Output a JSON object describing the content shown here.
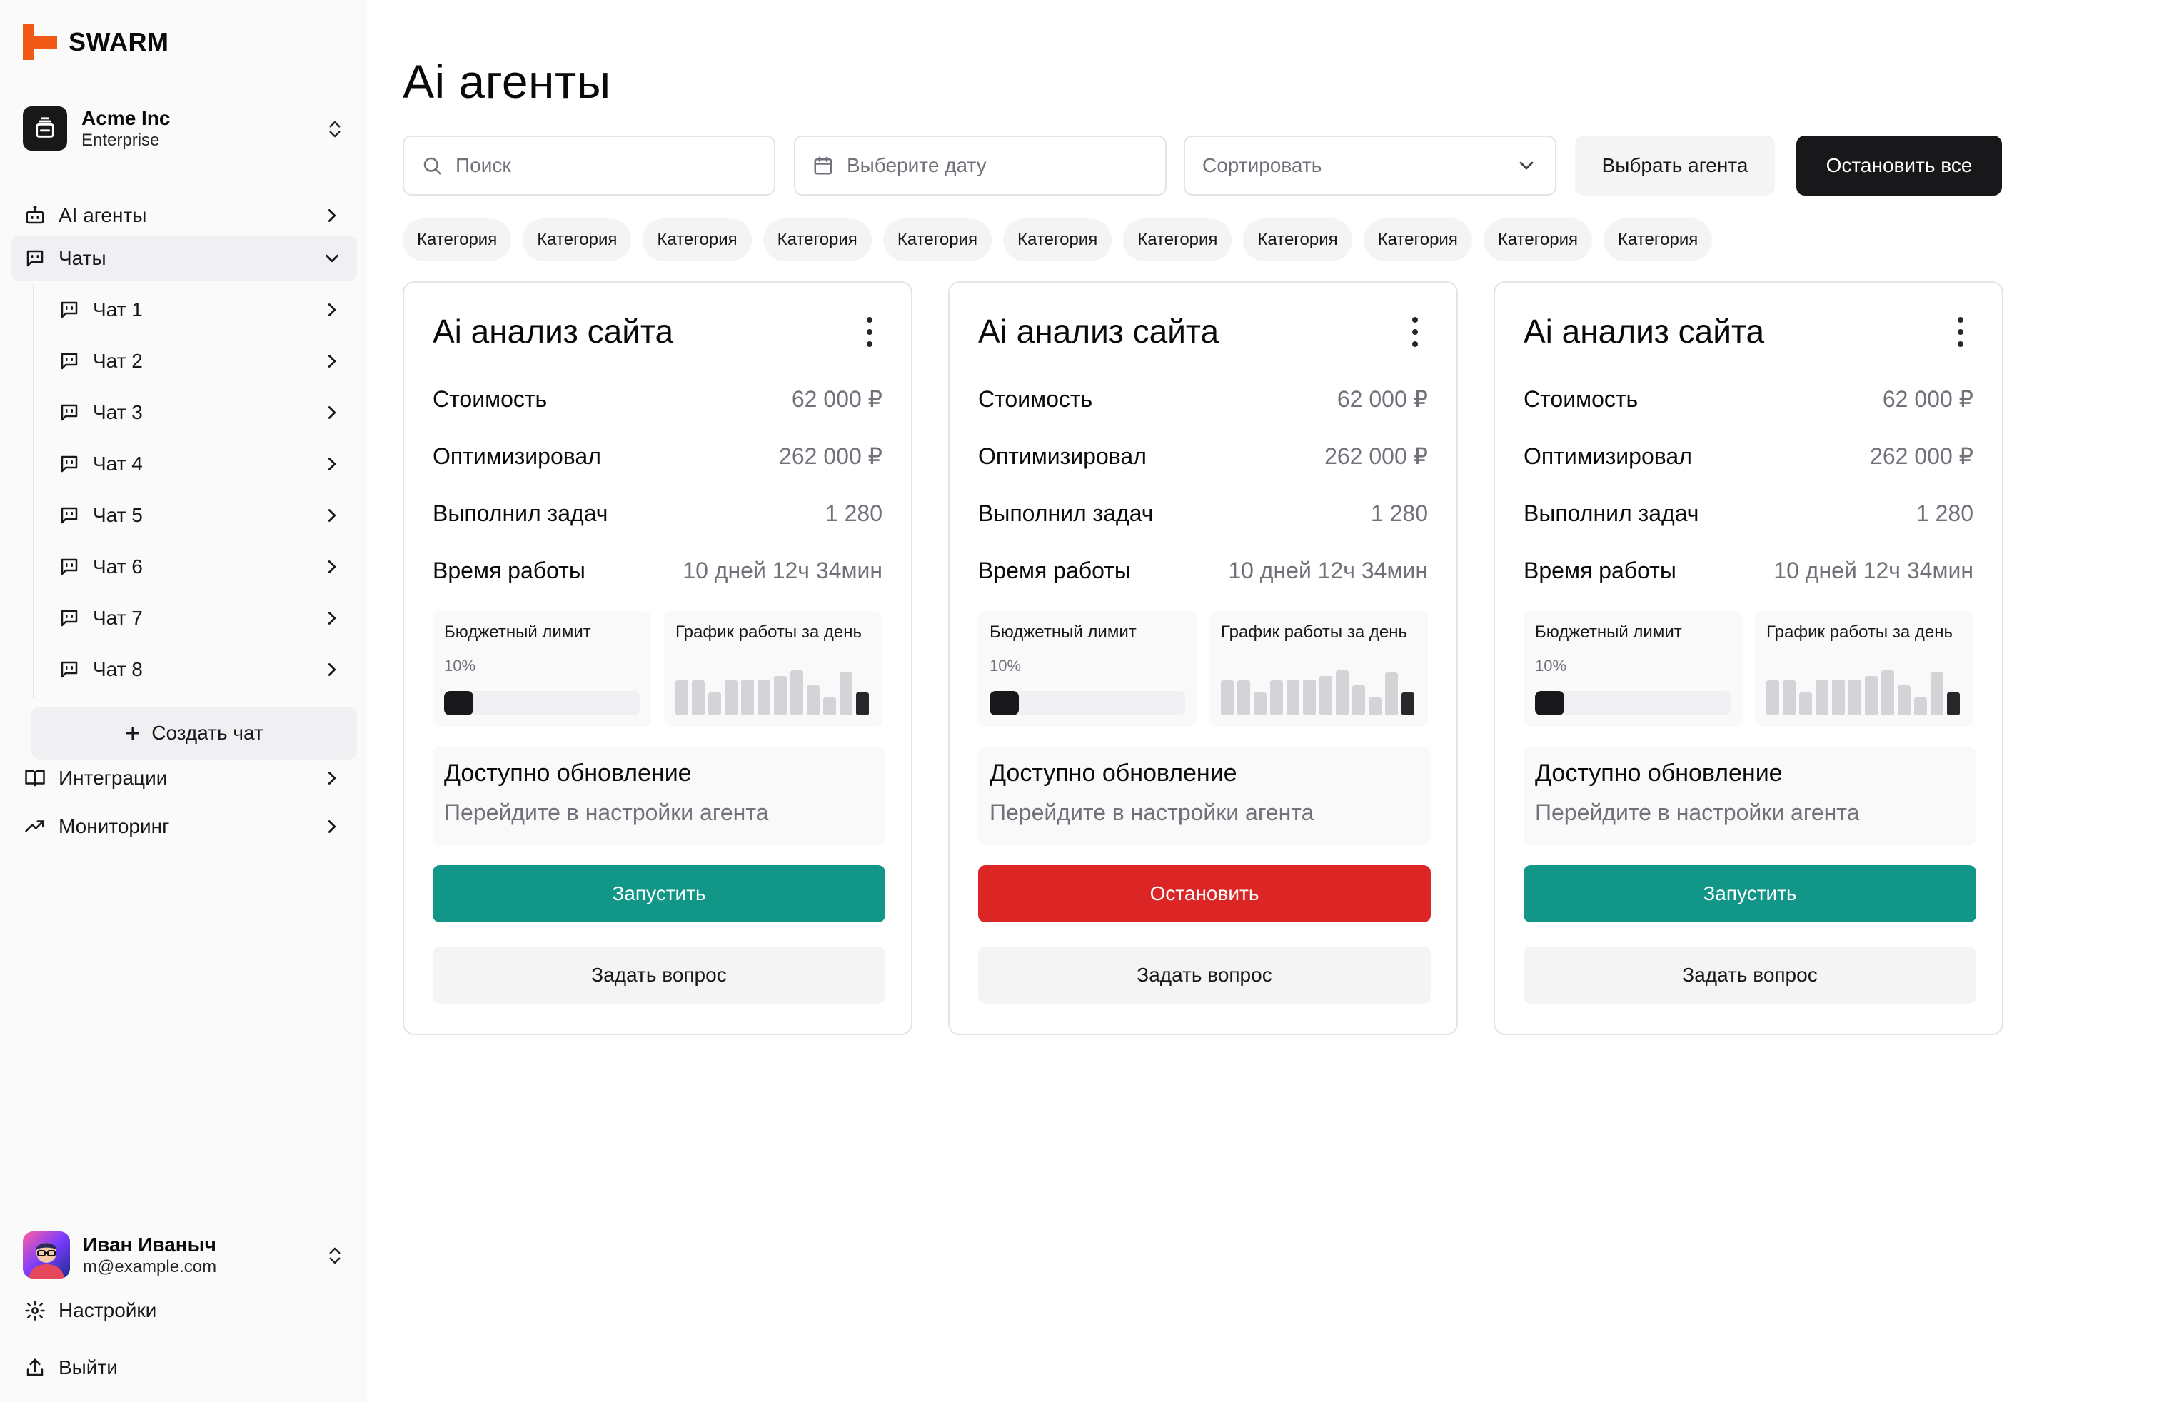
{
  "brand": {
    "name": "SWARM",
    "logo_color": "#f05a14"
  },
  "org": {
    "name": "Acme Inc",
    "plan": "Enterprise"
  },
  "nav": {
    "agents": "AI агенты",
    "chats": "Чаты",
    "chat_items": [
      "Чат 1",
      "Чат 2",
      "Чат 3",
      "Чат 4",
      "Чат 5",
      "Чат 6",
      "Чат 7",
      "Чат 8"
    ],
    "create_chat": "Создать чат",
    "integrations": "Интеграции",
    "monitoring": "Мониторинг"
  },
  "user": {
    "name": "Иван Иваныч",
    "email": "m@example.com"
  },
  "footer": {
    "settings": "Настройки",
    "logout": "Выйти"
  },
  "page": {
    "title": "Ai агенты"
  },
  "toolbar": {
    "search_placeholder": "Поиск",
    "date_placeholder": "Выберите дату",
    "sort_placeholder": "Сортировать",
    "choose_agent": "Выбрать агента",
    "stop_all": "Остановить все"
  },
  "categories": [
    "Категория",
    "Категория",
    "Категория",
    "Категория",
    "Категория",
    "Категория",
    "Категория",
    "Категория",
    "Категория",
    "Категория",
    "Категория"
  ],
  "colors": {
    "run": "#129688",
    "stop": "#dc2626",
    "primary": "#18181b"
  },
  "cards": [
    {
      "title": "Ai анализ сайта",
      "stats": [
        {
          "label": "Стоимость",
          "value": "62 000 ₽"
        },
        {
          "label": "Оптимизировал",
          "value": "262 000 ₽"
        },
        {
          "label": "Выполнил задач",
          "value": "1 280"
        },
        {
          "label": "Время работы",
          "value": "10 дней 12ч 34мин"
        }
      ],
      "budget_title": "Бюджетный лимит",
      "budget_percent_label": "10%",
      "budget_percent": 0.15,
      "chart_title": "График работы за день",
      "update_title": "Доступно обновление",
      "update_sub": "Перейдите в настройки агента",
      "action_label": "Запустить",
      "action_state": "run",
      "ask_label": "Задать вопрос"
    },
    {
      "title": "Ai анализ сайта",
      "stats": [
        {
          "label": "Стоимость",
          "value": "62 000 ₽"
        },
        {
          "label": "Оптимизировал",
          "value": "262 000 ₽"
        },
        {
          "label": "Выполнил задач",
          "value": "1 280"
        },
        {
          "label": "Время работы",
          "value": "10 дней 12ч 34мин"
        }
      ],
      "budget_title": "Бюджетный лимит",
      "budget_percent_label": "10%",
      "budget_percent": 0.15,
      "chart_title": "График работы за день",
      "update_title": "Доступно обновление",
      "update_sub": "Перейдите в настройки агента",
      "action_label": "Остановить",
      "action_state": "stop",
      "ask_label": "Задать вопрос"
    },
    {
      "title": "Ai анализ сайта",
      "stats": [
        {
          "label": "Стоимость",
          "value": "62 000 ₽"
        },
        {
          "label": "Оптимизировал",
          "value": "262 000 ₽"
        },
        {
          "label": "Выполнил задач",
          "value": "1 280"
        },
        {
          "label": "Время работы",
          "value": "10 дней 12ч 34мин"
        }
      ],
      "budget_title": "Бюджетный лимит",
      "budget_percent_label": "10%",
      "budget_percent": 0.15,
      "chart_title": "График работы за день",
      "update_title": "Доступно обновление",
      "update_sub": "Перейдите в настройки агента",
      "action_label": "Запустить",
      "action_state": "run",
      "ask_label": "Задать вопрос"
    }
  ],
  "day_chart": [
    0.7,
    0.7,
    0.45,
    0.7,
    0.72,
    0.72,
    0.78,
    0.9,
    0.6,
    0.35,
    0.85,
    0.45
  ]
}
